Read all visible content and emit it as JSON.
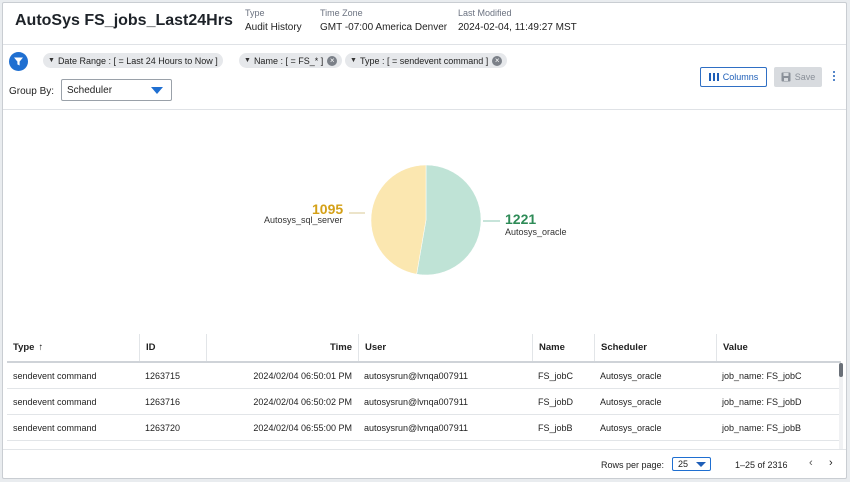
{
  "header": {
    "title": "AutoSys FS_jobs_Last24Hrs",
    "type_label": "Type",
    "type_value": "Audit History",
    "tz_label": "Time Zone",
    "tz_value": "GMT -07:00 America Denver",
    "modified_label": "Last Modified",
    "modified_value": "2024-02-04, 11:49:27 MST"
  },
  "filters": [
    {
      "label": "Date Range : [ = Last 24 Hours to Now ]"
    },
    {
      "label": "Name : [ = FS_* ]"
    },
    {
      "label": "Type : [ = sendevent command ]"
    }
  ],
  "group_by": {
    "label": "Group By:",
    "value": "Scheduler"
  },
  "toolbar": {
    "columns_label": "Columns",
    "save_label": "Save"
  },
  "colors": {
    "accent": "#1f6fd1",
    "oracle": "#2e8b57",
    "sql_server": "#d4a017"
  },
  "chart_data": {
    "type": "pie",
    "slices": [
      {
        "label": "Autosys_oracle",
        "value": 1221,
        "color": "#bfe3d6"
      },
      {
        "label": "Autosys_sql_server",
        "value": 1095,
        "color": "#fbe7b0"
      }
    ]
  },
  "table": {
    "columns": [
      "Type",
      "ID",
      "Time",
      "User",
      "Name",
      "Scheduler",
      "Value"
    ],
    "sort_indicator": "↑",
    "rows": [
      [
        "sendevent command",
        "1263715",
        "2024/02/04 06:50:01 PM",
        "autosysrun@lvnqa007911",
        "FS_jobC",
        "Autosys_oracle",
        "job_name: FS_jobC"
      ],
      [
        "sendevent command",
        "1263716",
        "2024/02/04 06:50:02 PM",
        "autosysrun@lvnqa007911",
        "FS_jobD",
        "Autosys_oracle",
        "job_name: FS_jobD"
      ],
      [
        "sendevent command",
        "1263720",
        "2024/02/04 06:55:00 PM",
        "autosysrun@lvnqa007911",
        "FS_jobB",
        "Autosys_oracle",
        "job_name: FS_jobB"
      ]
    ]
  },
  "footer": {
    "rows_per_page_label": "Rows per page:",
    "rows_per_page_value": "25",
    "range_text": "1–25 of 2316",
    "prev_icon": "‹",
    "next_icon": "›"
  }
}
